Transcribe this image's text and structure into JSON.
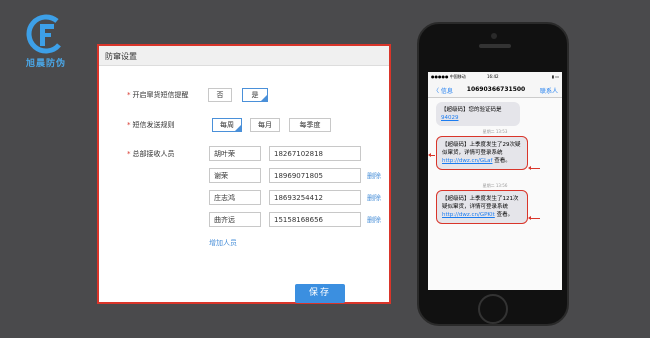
{
  "logo": {
    "text": "旭晨防伪"
  },
  "panel": {
    "title": "防窜设置",
    "rows": {
      "sms_alert": {
        "label": "开启窜货短信提醒",
        "options": [
          "否",
          "是"
        ],
        "selected": "是"
      },
      "frequency": {
        "label": "短信发送规则",
        "options": [
          "每周",
          "每月",
          "每季度"
        ],
        "selected": "每周"
      },
      "recipients": {
        "label": "总部接收人员"
      }
    },
    "recipients": [
      {
        "name": "胡叶荣",
        "phone": "18267102818",
        "delete": ""
      },
      {
        "name": "谢荣",
        "phone": "18969071805",
        "delete": "删除"
      },
      {
        "name": "庄志鸿",
        "phone": "18693254412",
        "delete": "删除"
      },
      {
        "name": "曲齐远",
        "phone": "15158168656",
        "delete": "删除"
      }
    ],
    "add_label": "增加人员",
    "save_label": "保存"
  },
  "phone": {
    "status": {
      "carrier": "●●●●● 中国移动",
      "time": "16:42",
      "battery": "▮ ▭"
    },
    "nav": {
      "back": "〈 信息",
      "title": "10690366731500",
      "contact": "联系人"
    },
    "messages": [
      {
        "text": "【超级码】您的验证码是",
        "link": "94029",
        "tail": ""
      },
      {
        "text": "【超级码】上季度发生了29次疑似窜货，详情可登录系统",
        "link": "http://dwz.cn/GLaf",
        "tail": "查看。"
      },
      {
        "text": "【超级码】上季度发生了121次疑似窜货，详情可登录系统",
        "link": "http://dwz.cn/GPKIt",
        "tail": "查看。"
      }
    ],
    "timestamps": [
      "星期二 13:53",
      "星期二 13:56"
    ]
  },
  "colors": {
    "accent": "#3b8fe0",
    "highlight": "#d9352a",
    "background": "#4a4a4c"
  }
}
